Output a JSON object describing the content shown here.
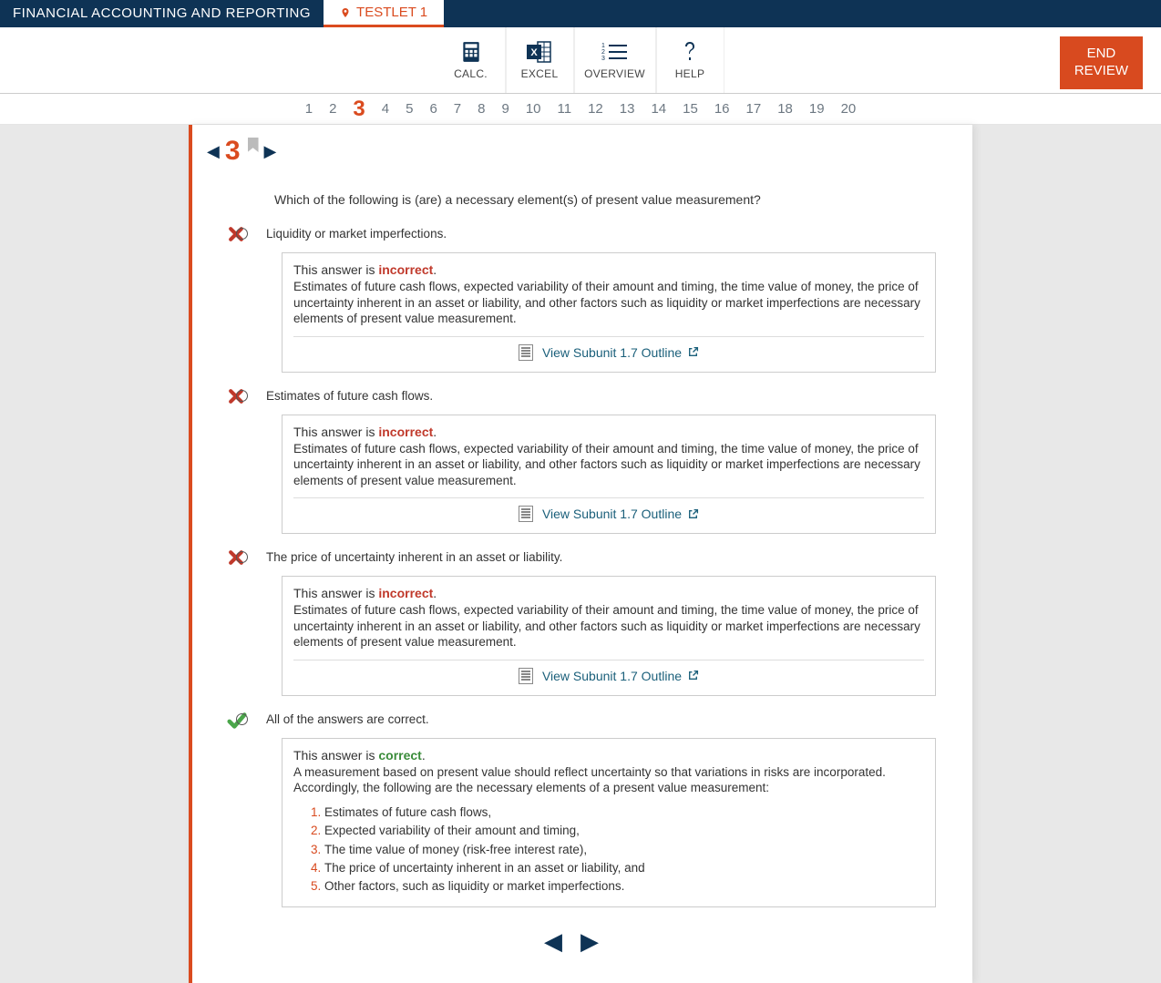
{
  "header": {
    "title": "FINANCIAL ACCOUNTING AND REPORTING",
    "testlet_label": "TESTLET 1"
  },
  "toolbar": {
    "calc": "CALC.",
    "excel": "EXCEL",
    "overview": "OVERVIEW",
    "help": "HELP",
    "end_review_line1": "END",
    "end_review_line2": "REVIEW"
  },
  "question_nav": {
    "items": [
      "1",
      "2",
      "3",
      "4",
      "5",
      "6",
      "7",
      "8",
      "9",
      "10",
      "11",
      "12",
      "13",
      "14",
      "15",
      "16",
      "17",
      "18",
      "19",
      "20"
    ],
    "current": "3"
  },
  "question": {
    "number": "3",
    "text": "Which of the following is (are) a necessary element(s) of present value measurement?",
    "answers": [
      {
        "label": "Liquidity or market imperfections.",
        "status": "incorrect",
        "intro_prefix": "This answer is ",
        "intro_status": "incorrect",
        "intro_suffix": ".",
        "body": "Estimates of future cash flows, expected variability of their amount and timing, the time value of money, the price of uncertainty inherent in an asset or liability, and other factors such as liquidity or market imperfections are necessary elements of present value measurement.",
        "subunit_link": "View Subunit 1.7 Outline"
      },
      {
        "label": "Estimates of future cash flows.",
        "status": "incorrect",
        "intro_prefix": "This answer is ",
        "intro_status": "incorrect",
        "intro_suffix": ".",
        "body": "Estimates of future cash flows, expected variability of their amount and timing, the time value of money, the price of uncertainty inherent in an asset or liability, and other factors such as liquidity or market imperfections are necessary elements of present value measurement.",
        "subunit_link": "View Subunit 1.7 Outline"
      },
      {
        "label": "The price of uncertainty inherent in an asset or liability.",
        "status": "incorrect",
        "intro_prefix": "This answer is ",
        "intro_status": "incorrect",
        "intro_suffix": ".",
        "body": "Estimates of future cash flows, expected variability of their amount and timing, the time value of money, the price of uncertainty inherent in an asset or liability, and other factors such as liquidity or market imperfections are necessary elements of present value measurement.",
        "subunit_link": "View Subunit 1.7 Outline"
      },
      {
        "label": "All of the answers are correct.",
        "status": "correct",
        "intro_prefix": "This answer is ",
        "intro_status": "correct",
        "intro_suffix": ".",
        "body": "A measurement based on present value should reflect uncertainty so that variations in risks are incorporated. Accordingly, the following are the necessary elements of a present value measurement:",
        "list": [
          "Estimates of future cash flows,",
          "Expected variability of their amount and timing,",
          "The time value of money (risk-free interest rate),",
          "The price of uncertainty inherent in an asset or liability, and",
          "Other factors, such as liquidity or market imperfections."
        ]
      }
    ]
  }
}
